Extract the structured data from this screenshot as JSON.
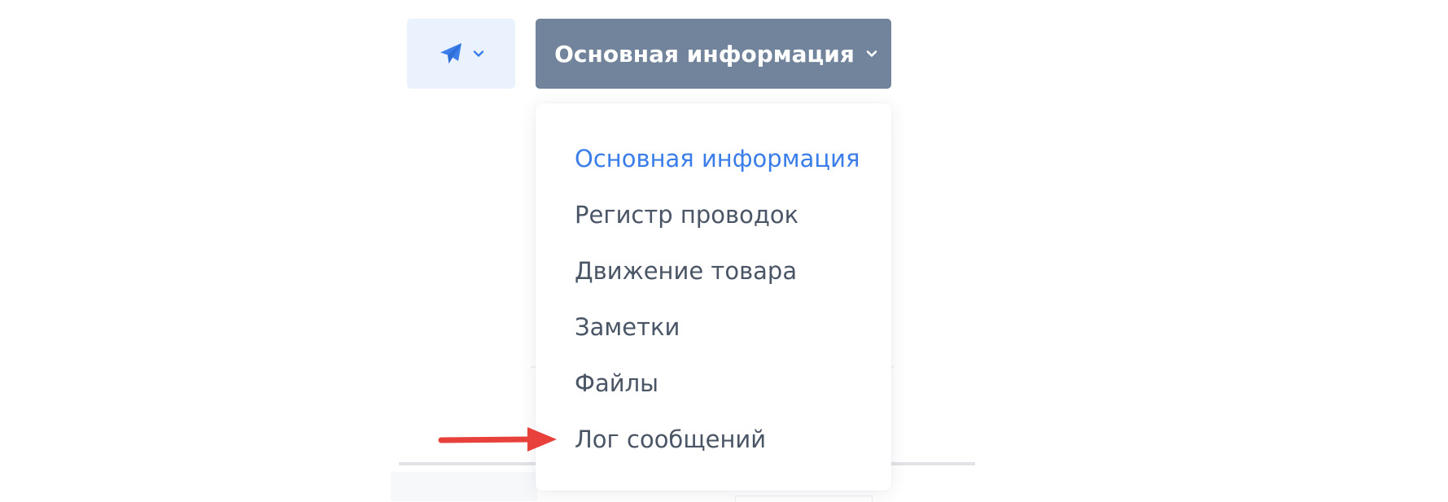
{
  "toolbar": {
    "send_button_icon": "paper-plane-icon",
    "send_button_dropdown_icon": "chevron-down-icon",
    "section_select_label": "Основная информация",
    "section_select_icon": "chevron-down-icon"
  },
  "dropdown": {
    "items": [
      {
        "label": "Основная информация",
        "active": true
      },
      {
        "label": "Регистр проводок",
        "active": false
      },
      {
        "label": "Движение товара",
        "active": false
      },
      {
        "label": "Заметки",
        "active": false
      },
      {
        "label": "Файлы",
        "active": false
      },
      {
        "label": "Лог сообщений",
        "active": false
      }
    ]
  },
  "annotation": {
    "arrow_icon": "red-arrow-icon",
    "points_to": "Лог сообщений"
  },
  "colors": {
    "send_button_bg": "#eaf2fe",
    "accent_blue": "#3b7de9",
    "section_button_bg": "#71849b",
    "menu_text": "#4a5566",
    "arrow_red": "#e8413b"
  }
}
